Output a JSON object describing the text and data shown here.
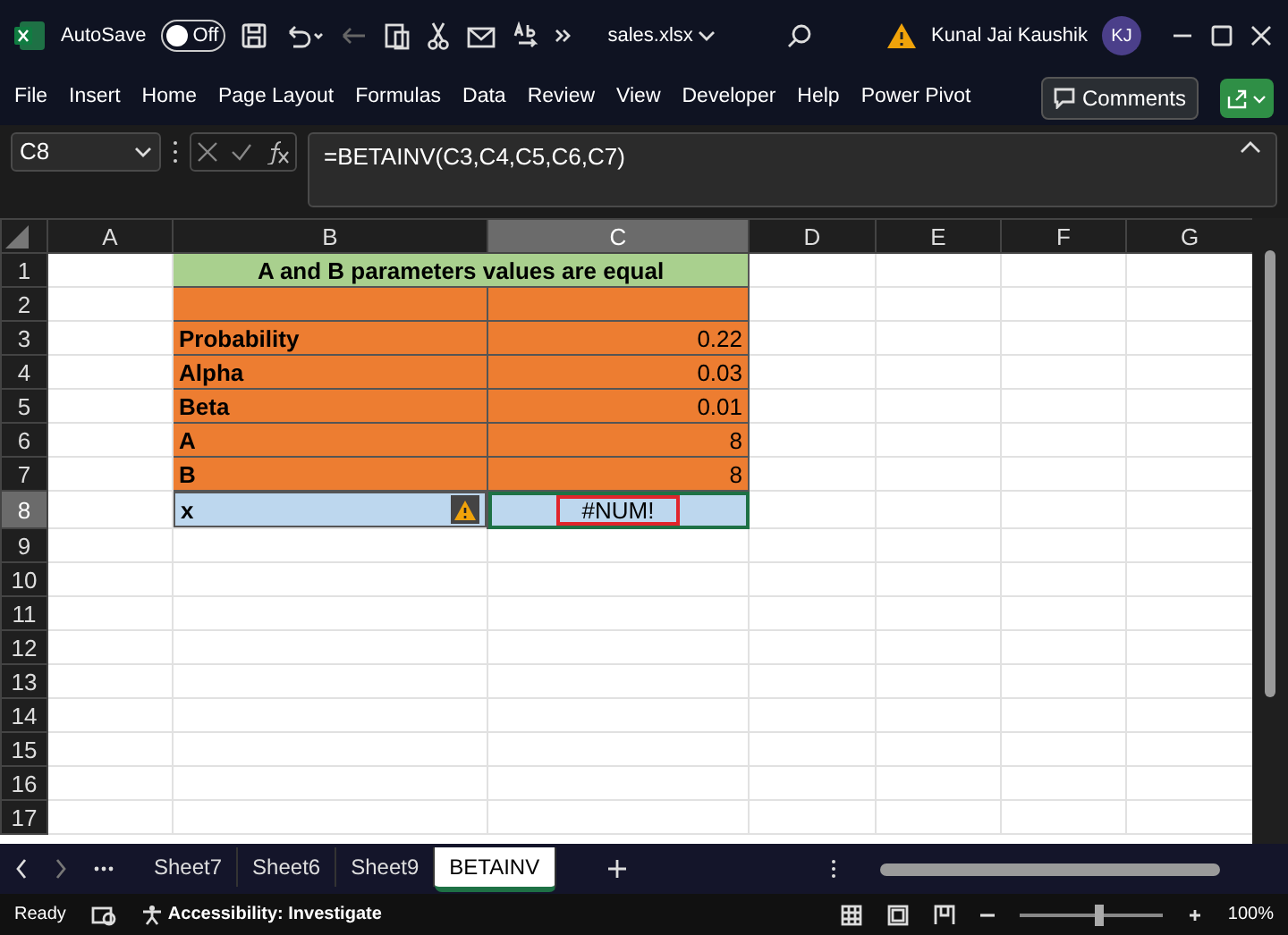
{
  "title_bar": {
    "autosave_label": "AutoSave",
    "autosave_on": false,
    "autosave_state": "Off",
    "file_name": "sales.xlsx",
    "user_name": "Kunal Jai Kaushik",
    "user_initials": "KJ"
  },
  "menu": [
    {
      "label": "File"
    },
    {
      "label": "Insert"
    },
    {
      "label": "Home"
    },
    {
      "label": "Page Layout"
    },
    {
      "label": "Formulas"
    },
    {
      "label": "Data"
    },
    {
      "label": "Review"
    },
    {
      "label": "View"
    },
    {
      "label": "Developer"
    },
    {
      "label": "Help"
    },
    {
      "label": "Power Pivot"
    }
  ],
  "comments_button": "Comments",
  "formula_bar": {
    "name_box": "C8",
    "formula": "=BETAINV(C3,C4,C5,C6,C7)"
  },
  "columns": [
    {
      "label": "A",
      "selected": false
    },
    {
      "label": "B",
      "selected": false
    },
    {
      "label": "C",
      "selected": true
    },
    {
      "label": "D",
      "selected": false
    },
    {
      "label": "E",
      "selected": false
    },
    {
      "label": "F",
      "selected": false
    },
    {
      "label": "G",
      "selected": false
    }
  ],
  "rows": [
    {
      "number": "1",
      "selected": false,
      "kind": "title",
      "text": "A and B parameters values are equal"
    },
    {
      "number": "2",
      "selected": false,
      "kind": "input"
    },
    {
      "number": "3",
      "selected": false,
      "kind": "input",
      "label": "Probability",
      "value": "0.22"
    },
    {
      "number": "4",
      "selected": false,
      "kind": "input",
      "label": "Alpha",
      "value": "0.03"
    },
    {
      "number": "5",
      "selected": false,
      "kind": "input",
      "label": "Beta",
      "value": "0.01"
    },
    {
      "number": "6",
      "selected": false,
      "kind": "input",
      "label": "A",
      "value": "8"
    },
    {
      "number": "7",
      "selected": false,
      "kind": "input",
      "label": "B",
      "value": "8"
    },
    {
      "number": "8",
      "selected": true,
      "kind": "result",
      "label": "x",
      "value": "#NUM!",
      "warning": true,
      "highlighted": true
    },
    {
      "number": "9",
      "selected": false,
      "kind": "empty"
    },
    {
      "number": "10",
      "selected": false,
      "kind": "empty"
    },
    {
      "number": "11",
      "selected": false,
      "kind": "empty"
    },
    {
      "number": "12",
      "selected": false,
      "kind": "empty"
    },
    {
      "number": "13",
      "selected": false,
      "kind": "empty"
    },
    {
      "number": "14",
      "selected": false,
      "kind": "empty"
    },
    {
      "number": "15",
      "selected": false,
      "kind": "empty"
    },
    {
      "number": "16",
      "selected": false,
      "kind": "empty"
    },
    {
      "number": "17",
      "selected": false,
      "kind": "empty"
    }
  ],
  "sheet_tabs": [
    {
      "label": "Sheet7",
      "selected": false
    },
    {
      "label": "Sheet6",
      "selected": false
    },
    {
      "label": "Sheet9",
      "selected": false
    },
    {
      "label": "BETAINV",
      "selected": true
    }
  ],
  "status_bar": {
    "status": "Ready",
    "accessibility": "Accessibility: Investigate",
    "zoom_slider": {
      "level": 0.55
    },
    "zoom": "100%"
  }
}
